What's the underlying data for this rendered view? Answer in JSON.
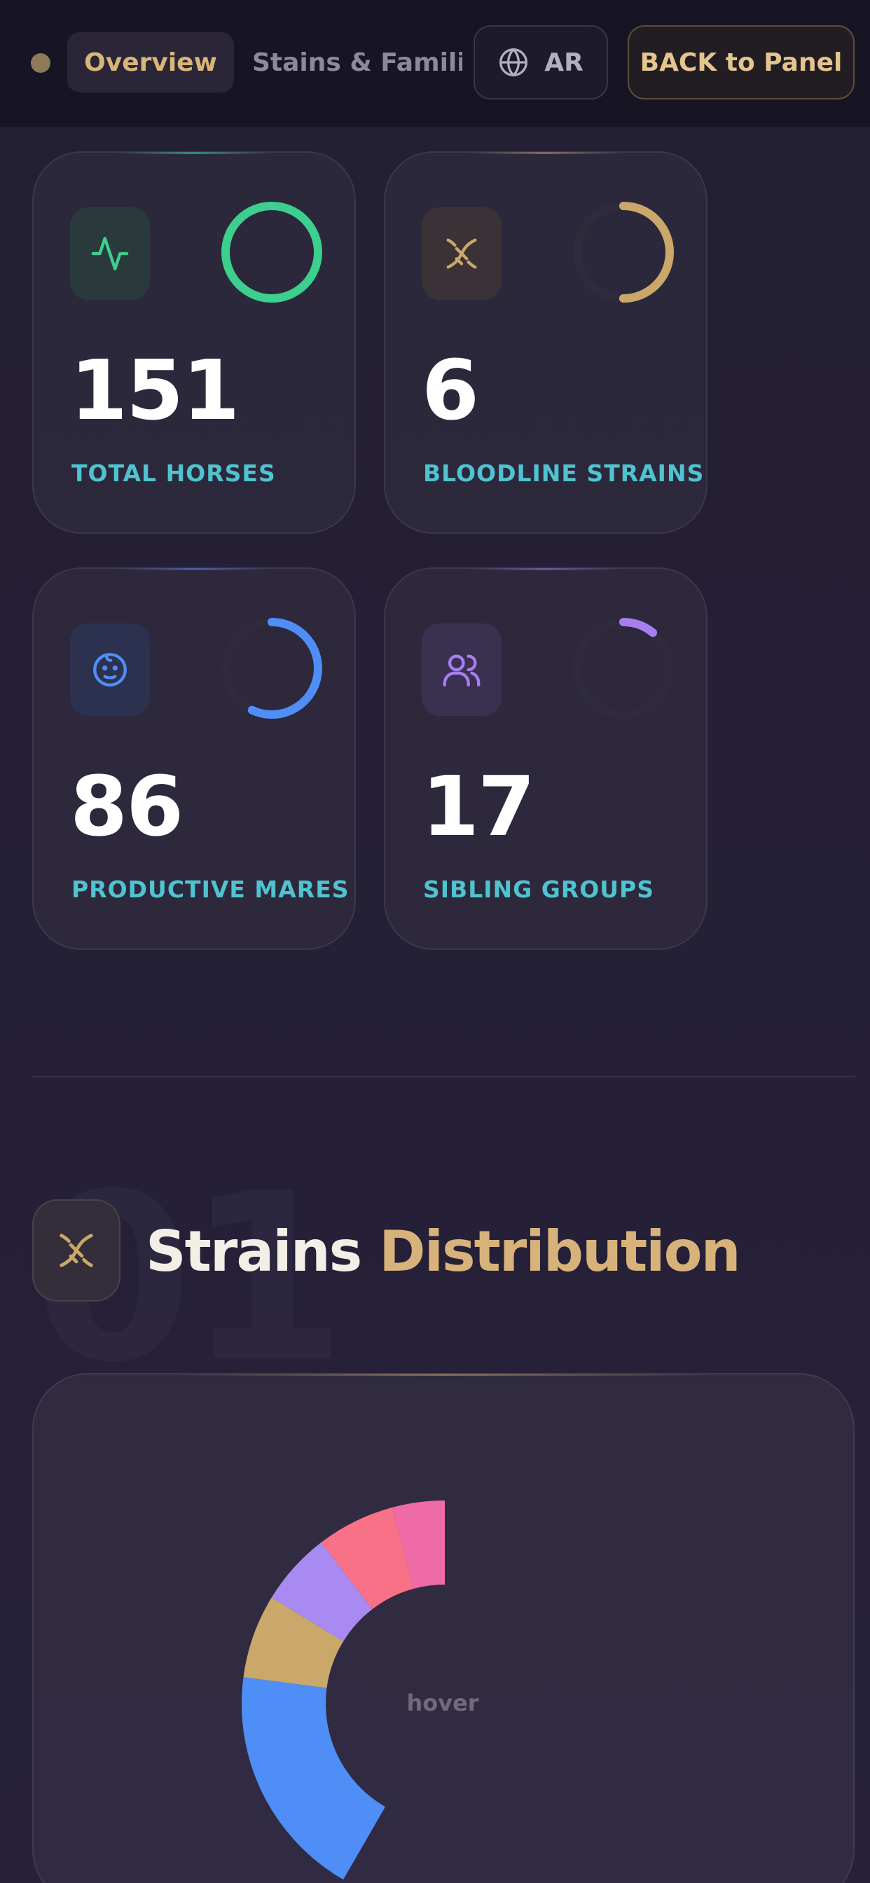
{
  "nav": {
    "overview_label": "Overview",
    "strains_label": "Stains & Familie",
    "language_label": "AR",
    "back_label": "BACK to Panel"
  },
  "stats": [
    {
      "value": "151",
      "label": "TOTAL HORSES",
      "icon": "activity-icon",
      "accent": "#3ccf8e",
      "ring_fraction": 1.0
    },
    {
      "value": "6",
      "label": "BLOODLINE STRAINS",
      "icon": "dna-icon",
      "accent": "#c9a86a",
      "ring_fraction": 0.5
    },
    {
      "value": "86",
      "label": "PRODUCTIVE MARES",
      "icon": "baby-icon",
      "accent": "#4f8ef7",
      "ring_fraction": 0.57
    },
    {
      "value": "17",
      "label": "SIBLING GROUPS",
      "icon": "users-icon",
      "accent": "#a77ef0",
      "ring_fraction": 0.11
    }
  ],
  "section": {
    "number": "01",
    "title_part1": "Strains",
    "title_part2": "Distribution",
    "icon": "dna-icon"
  },
  "chart_data": {
    "type": "pie",
    "variant": "half-donut",
    "center_text": "hover",
    "slices": [
      {
        "color": "#4f8ef7",
        "fraction": 0.45
      },
      {
        "color": "#c9a86a",
        "fraction": 0.16
      },
      {
        "color": "#a88af2",
        "fraction": 0.14
      },
      {
        "color": "#f87187",
        "fraction": 0.15
      },
      {
        "color": "#ef6ba8",
        "fraction": 0.1
      }
    ]
  }
}
